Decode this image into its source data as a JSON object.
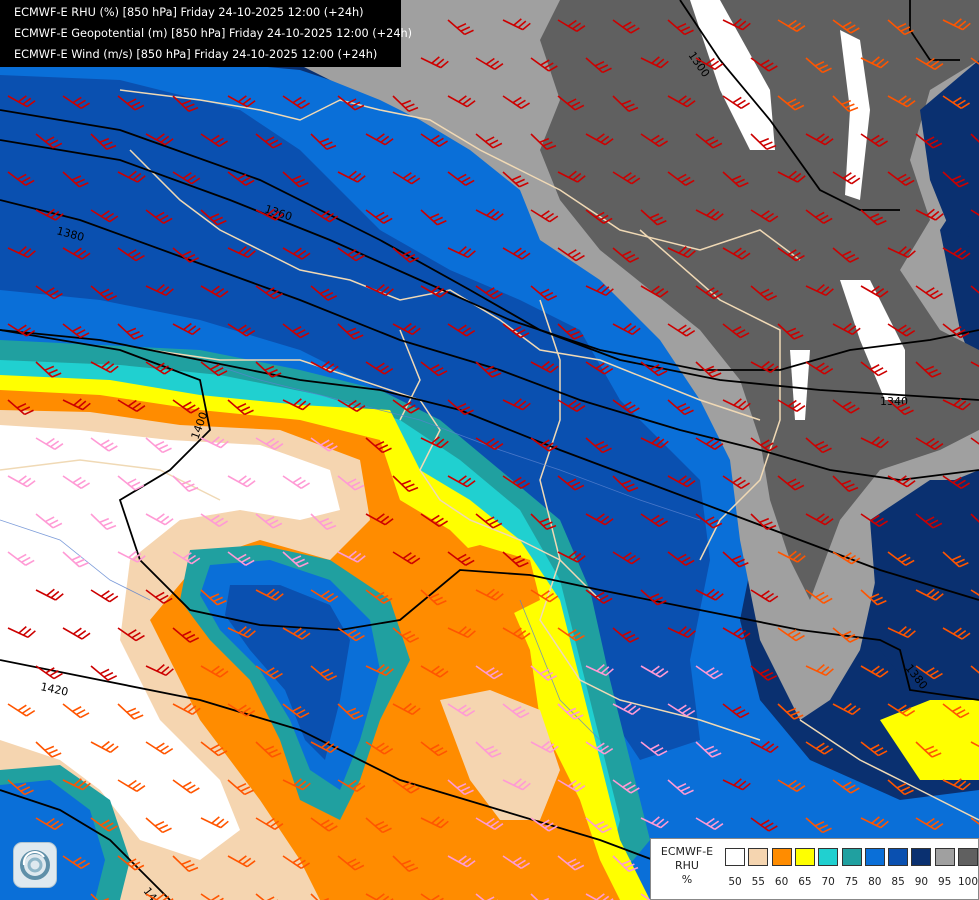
{
  "title_lines": [
    "ECMWF-E RHU (%) [850 hPa] Friday 24-10-2025 12:00 (+24h)",
    "ECMWF-E Geopotential (m) [850 hPa] Friday 24-10-2025 12:00 (+24h)",
    "ECMWF-E Wind (m/s) [850 hPa] Friday 24-10-2025 12:00 (+24h)"
  ],
  "legend": {
    "model": "ECMWF-E",
    "variable": "RHU",
    "unit": "%",
    "ticks": [
      "50",
      "55",
      "60",
      "65",
      "70",
      "75",
      "80",
      "85",
      "90",
      "95",
      "100"
    ],
    "colors": [
      "#ffffff",
      "#f5d5b0",
      "#ff8c00",
      "#ffff00",
      "#20d0d0",
      "#20a0a0",
      "#0a6fd8",
      "#0a50b0",
      "#0a3070",
      "#a0a0a0",
      "#606060"
    ]
  },
  "contour_labels": [
    "1300",
    "1360",
    "1380",
    "1400",
    "1420",
    "1440",
    "1340",
    "1380"
  ],
  "palette": {
    "white": "#ffffff",
    "cream": "#f5d5b0",
    "orange": "#ff8c00",
    "yellow": "#ffff00",
    "cyan": "#20d0d0",
    "teal": "#20a0a0",
    "blue": "#0a6fd8",
    "mid_blue": "#0a50b0",
    "navy": "#0a3070",
    "grey": "#a0a0a0",
    "dark_grey": "#606060",
    "barb_red": "#cc0000",
    "barb_orange": "#ff5500",
    "barb_pink": "#ff9ad5",
    "border": "#f0d9b5"
  }
}
